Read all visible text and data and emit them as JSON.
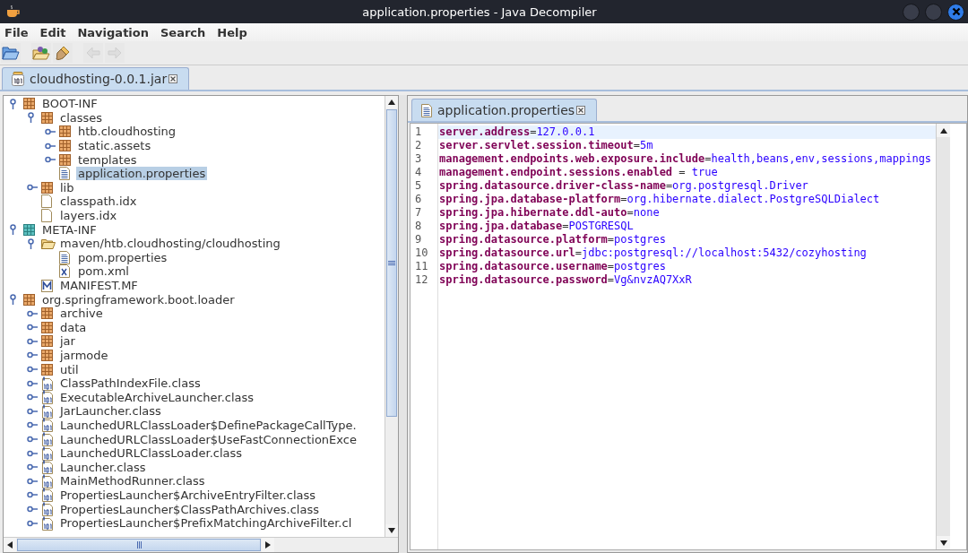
{
  "window": {
    "title": "application.properties - Java Decompiler"
  },
  "menu": [
    "File",
    "Edit",
    "Navigation",
    "Search",
    "Help"
  ],
  "tabs": [
    {
      "label": "cloudhosting-0.0.1.jar",
      "selected": true
    }
  ],
  "tree": [
    {
      "label": "BOOT-INF",
      "kind": "package",
      "expanded": true,
      "selected": false,
      "children": [
        {
          "label": "classes",
          "kind": "package",
          "expanded": true,
          "selected": false,
          "children": [
            {
              "label": "htb.cloudhosting",
              "kind": "package",
              "expanded": false,
              "selected": false
            },
            {
              "label": "static.assets",
              "kind": "package",
              "expanded": false,
              "selected": false
            },
            {
              "label": "templates",
              "kind": "package",
              "expanded": false,
              "selected": false
            },
            {
              "label": "application.properties",
              "kind": "text",
              "selected": true
            }
          ]
        },
        {
          "label": "lib",
          "kind": "package",
          "expanded": false,
          "selected": false
        },
        {
          "label": "classpath.idx",
          "kind": "file",
          "selected": false
        },
        {
          "label": "layers.idx",
          "kind": "file",
          "selected": false
        }
      ]
    },
    {
      "label": "META-INF",
      "kind": "meta",
      "expanded": true,
      "selected": false,
      "children": [
        {
          "label": "maven/htb.cloudhosting/cloudhosting",
          "kind": "folder",
          "expanded": true,
          "selected": false,
          "children": [
            {
              "label": "pom.properties",
              "kind": "text",
              "selected": false
            },
            {
              "label": "pom.xml",
              "kind": "xml",
              "selected": false
            }
          ]
        },
        {
          "label": "MANIFEST.MF",
          "kind": "manifest",
          "selected": false
        }
      ]
    },
    {
      "label": "org.springframework.boot.loader",
      "kind": "package",
      "expanded": true,
      "selected": false,
      "children": [
        {
          "label": "archive",
          "kind": "package",
          "expanded": false,
          "selected": false
        },
        {
          "label": "data",
          "kind": "package",
          "expanded": false,
          "selected": false
        },
        {
          "label": "jar",
          "kind": "package",
          "expanded": false,
          "selected": false
        },
        {
          "label": "jarmode",
          "kind": "package",
          "expanded": false,
          "selected": false
        },
        {
          "label": "util",
          "kind": "package",
          "expanded": false,
          "selected": false
        },
        {
          "label": "ClassPathIndexFile.class",
          "kind": "class",
          "expanded": false,
          "selected": false
        },
        {
          "label": "ExecutableArchiveLauncher.class",
          "kind": "class",
          "expanded": false,
          "selected": false
        },
        {
          "label": "JarLauncher.class",
          "kind": "class",
          "expanded": false,
          "selected": false
        },
        {
          "label": "LaunchedURLClassLoader$DefinePackageCallType.",
          "kind": "class",
          "expanded": false,
          "selected": false
        },
        {
          "label": "LaunchedURLClassLoader$UseFastConnectionExce",
          "kind": "class",
          "expanded": false,
          "selected": false
        },
        {
          "label": "LaunchedURLClassLoader.class",
          "kind": "class",
          "expanded": false,
          "selected": false
        },
        {
          "label": "Launcher.class",
          "kind": "class",
          "expanded": false,
          "selected": false
        },
        {
          "label": "MainMethodRunner.class",
          "kind": "class",
          "expanded": false,
          "selected": false
        },
        {
          "label": "PropertiesLauncher$ArchiveEntryFilter.class",
          "kind": "class",
          "expanded": false,
          "selected": false
        },
        {
          "label": "PropertiesLauncher$ClassPathArchives.class",
          "kind": "class",
          "expanded": false,
          "selected": false
        },
        {
          "label": "PropertiesLauncher$PrefixMatchingArchiveFilter.cl",
          "kind": "class",
          "expanded": false,
          "selected": false
        }
      ]
    }
  ],
  "editor": {
    "tabs": [
      {
        "label": "application.properties",
        "selected": true
      }
    ],
    "lines": [
      {
        "number": "1",
        "key": "server.address",
        "sep": "=",
        "value": "127.0.0.1",
        "current": true
      },
      {
        "number": "2",
        "key": "server.servlet.session.timeout",
        "sep": "=",
        "value": "5m",
        "current": false
      },
      {
        "number": "3",
        "key": "management.endpoints.web.exposure.include",
        "sep": "=",
        "value": "health,beans,env,sessions,mappings",
        "current": false
      },
      {
        "number": "4",
        "key": "management.endpoint.sessions.enabled",
        "sep": " = ",
        "value": "true",
        "current": false
      },
      {
        "number": "5",
        "key": "spring.datasource.driver-class-name",
        "sep": "=",
        "value": "org.postgresql.Driver",
        "current": false
      },
      {
        "number": "6",
        "key": "spring.jpa.database-platform",
        "sep": "=",
        "value": "org.hibernate.dialect.PostgreSQLDialect",
        "current": false
      },
      {
        "number": "7",
        "key": "spring.jpa.hibernate.ddl-auto",
        "sep": "=",
        "value": "none",
        "current": false
      },
      {
        "number": "8",
        "key": "spring.jpa.database",
        "sep": "=",
        "value": "POSTGRESQL",
        "current": false
      },
      {
        "number": "9",
        "key": "spring.datasource.platform",
        "sep": "=",
        "value": "postgres",
        "current": false
      },
      {
        "number": "10",
        "key": "spring.datasource.url",
        "sep": "=",
        "value": "jdbc:postgresql://localhost:5432/cozyhosting",
        "current": false
      },
      {
        "number": "11",
        "key": "spring.datasource.username",
        "sep": "=",
        "value": "postgres",
        "current": false
      },
      {
        "number": "12",
        "key": "spring.datasource.password",
        "sep": "=",
        "value": "Vg&nvzAQ7XxR",
        "current": false
      }
    ]
  }
}
